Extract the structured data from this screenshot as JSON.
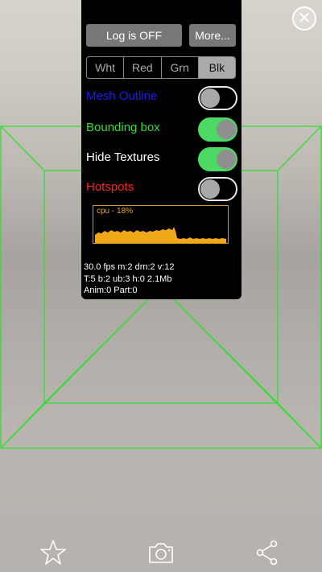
{
  "log_button": "Log is OFF",
  "more_button": "More...",
  "color_modes": [
    {
      "label": "Wht",
      "active": false
    },
    {
      "label": "Red",
      "active": false
    },
    {
      "label": "Grn",
      "active": false
    },
    {
      "label": "Blk",
      "active": true
    }
  ],
  "options": [
    {
      "label": "Mesh Outline",
      "color": "#1a1aff",
      "on": false
    },
    {
      "label": "Bounding box",
      "color": "#33dd33",
      "on": true
    },
    {
      "label": "Hide Textures",
      "color": "#ffffff",
      "on": true
    },
    {
      "label": "Hotspots",
      "color": "#ff2020",
      "on": false
    }
  ],
  "cpu": {
    "label": "cpu - 18%",
    "color": "#f0a818"
  },
  "stats": {
    "line1": "30.0 fps m:2 drn:2 v:12",
    "line2": "T:5 b:2 ub:3 h:0 2.1Mb",
    "line3": "Anim:0 Part:0"
  },
  "wireframe_color": "#33dd33",
  "toolbar_icons": [
    "star-icon",
    "camera-icon",
    "share-icon"
  ]
}
